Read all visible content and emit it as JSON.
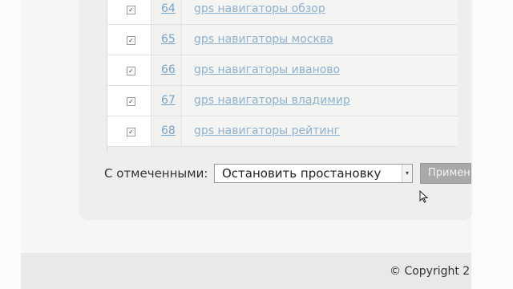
{
  "rows": [
    {
      "num": "64",
      "keyword": "gps навигаторы обзор",
      "checked": true
    },
    {
      "num": "65",
      "keyword": "gps навигаторы москва",
      "checked": true
    },
    {
      "num": "66",
      "keyword": "gps навигаторы иваново",
      "checked": true
    },
    {
      "num": "67",
      "keyword": "gps навигаторы владимир",
      "checked": true
    },
    {
      "num": "68",
      "keyword": "gps навигаторы рейтинг",
      "checked": true
    }
  ],
  "bulk_action": {
    "label": "С отмеченными:",
    "selected": "Остановить простановку",
    "apply_label": "Применить"
  },
  "footer": {
    "copyright": "© Copyright 2"
  },
  "colors": {
    "link": "#8db2cf",
    "button": "#a9a9a9"
  }
}
